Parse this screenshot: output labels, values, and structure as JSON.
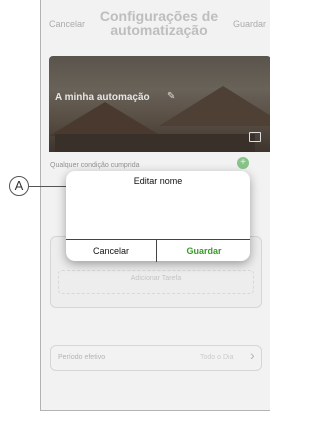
{
  "header": {
    "cancel_label": "Cancelar",
    "title": "Configurações de automatização",
    "save_label": "Guardar"
  },
  "hero": {
    "title": "A minha automação",
    "edit_icon": "pencil-icon",
    "image_icon": "image-icon"
  },
  "conditions": {
    "label": "Qualquer condição cumprida",
    "add_icon": "plus-icon"
  },
  "actions": {
    "add_label": "Adicionar Tarefa"
  },
  "period": {
    "label": "Período efetivo",
    "value": "Todo o Dia"
  },
  "callout": {
    "label": "A"
  },
  "dialog": {
    "title": "Editar nome",
    "cancel_label": "Cancelar",
    "save_label": "Guardar"
  },
  "colors": {
    "accent": "#3a9a2a"
  }
}
